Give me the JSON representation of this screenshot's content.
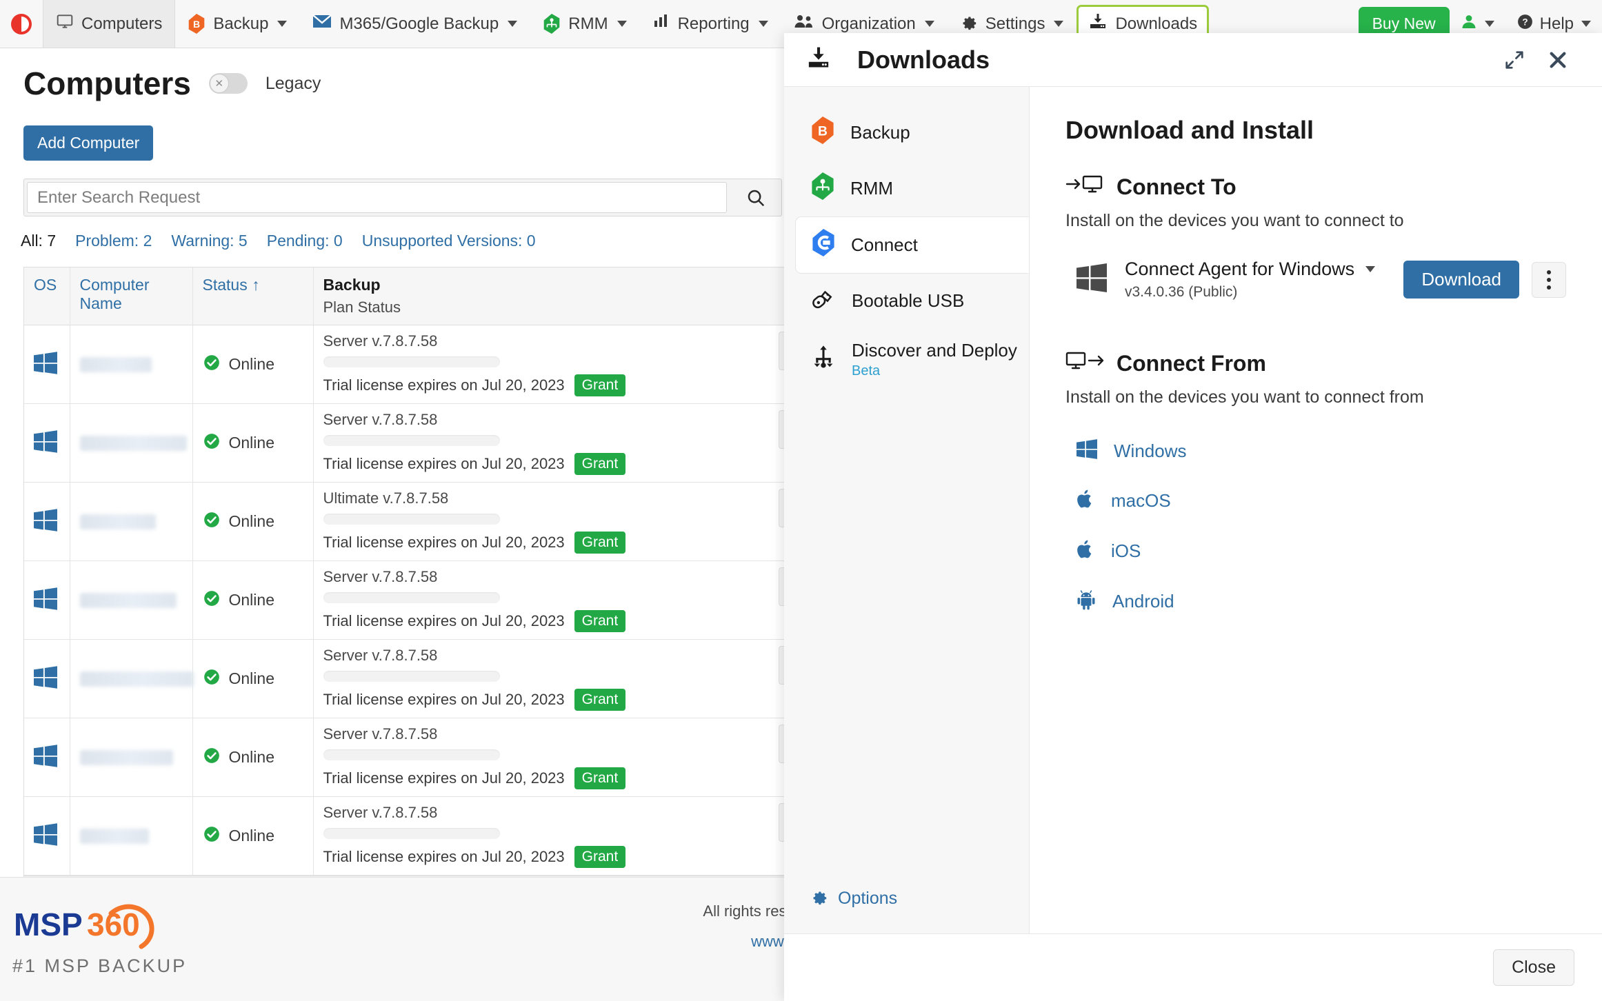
{
  "nav": {
    "logo_icon": "msp360-mark-icon",
    "items": [
      {
        "label": "Computers",
        "icon": "monitor-icon",
        "caret": false,
        "active": true,
        "boxed": false
      },
      {
        "label": "Backup",
        "icon": "backup-hex-icon",
        "caret": true,
        "active": false,
        "boxed": false
      },
      {
        "label": "M365/Google Backup",
        "icon": "envelope-icon",
        "caret": true,
        "active": false,
        "boxed": false
      },
      {
        "label": "RMM",
        "icon": "rmm-hex-icon",
        "caret": true,
        "active": false,
        "boxed": false
      },
      {
        "label": "Reporting",
        "icon": "bar-chart-icon",
        "caret": true,
        "active": false,
        "boxed": false
      },
      {
        "label": "Organization",
        "icon": "users-icon",
        "caret": true,
        "active": false,
        "boxed": false
      },
      {
        "label": "Settings",
        "icon": "gear-icon",
        "caret": true,
        "active": false,
        "boxed": false
      },
      {
        "label": "Downloads",
        "icon": "download-tray-icon",
        "caret": false,
        "active": false,
        "boxed": true
      }
    ],
    "buy_new_label": "Buy New",
    "account_icon": "user-icon",
    "help_label": "Help",
    "help_icon": "question-circle-icon"
  },
  "page": {
    "title": "Computers",
    "legacy_toggle_label": "Legacy",
    "legacy_toggle_state": "off",
    "add_computer_label": "Add Computer",
    "search_placeholder": "Enter Search Request",
    "search_value": "",
    "search_icon": "search-icon",
    "filters": [
      {
        "label": "All: 7",
        "active": true
      },
      {
        "label": "Problem: 2",
        "active": false
      },
      {
        "label": "Warning: 5",
        "active": false
      },
      {
        "label": "Pending: 0",
        "active": false
      },
      {
        "label": "Unsupported Versions: 0",
        "active": false
      }
    ],
    "table": {
      "headers": {
        "os": "OS",
        "computer_name": "Computer Name",
        "status": "Status",
        "status_sort_icon": "sort-asc-arrow-icon",
        "backup": "Backup",
        "backup_sub": "Plan Status"
      },
      "rows": [
        {
          "os_icon": "windows-icon",
          "name": "",
          "status": "Online",
          "status_icon": "check-circle-icon",
          "plan": "Server v.7.8.7.58",
          "license": "Trial license expires on Jul 20, 2023",
          "grant": "Grant"
        },
        {
          "os_icon": "windows-icon",
          "name": "",
          "status": "Online",
          "status_icon": "check-circle-icon",
          "plan": "Server v.7.8.7.58",
          "license": "Trial license expires on Jul 20, 2023",
          "grant": "Grant"
        },
        {
          "os_icon": "windows-icon",
          "name": "",
          "status": "Online",
          "status_icon": "check-circle-icon",
          "plan": "Ultimate v.7.8.7.58",
          "license": "Trial license expires on Jul 20, 2023",
          "grant": "Grant"
        },
        {
          "os_icon": "windows-icon",
          "name": "",
          "status": "Online",
          "status_icon": "check-circle-icon",
          "plan": "Server v.7.8.7.58",
          "license": "Trial license expires on Jul 20, 2023",
          "grant": "Grant"
        },
        {
          "os_icon": "windows-icon",
          "name": "",
          "status": "Online",
          "status_icon": "check-circle-icon",
          "plan": "Server v.7.8.7.58",
          "license": "Trial license expires on Jul 20, 2023",
          "grant": "Grant"
        },
        {
          "os_icon": "windows-icon",
          "name": "",
          "status": "Online",
          "status_icon": "check-circle-icon",
          "plan": "Server v.7.8.7.58",
          "license": "Trial license expires on Jul 20, 2023",
          "grant": "Grant"
        },
        {
          "os_icon": "windows-icon",
          "name": "",
          "status": "Online",
          "status_icon": "check-circle-icon",
          "plan": "Server v.7.8.7.58",
          "license": "Trial license expires on Jul 20, 2023",
          "grant": "Grant"
        }
      ]
    }
  },
  "footer": {
    "logo_text_a": "MSP",
    "logo_text_b": "360",
    "tagline": "#1 MSP BACKUP",
    "rights": "All rights reser",
    "site": "www.m"
  },
  "panel": {
    "title": "Downloads",
    "title_icon": "download-tray-icon",
    "expand_icon": "expand-diagonal-icon",
    "close_icon": "close-x-icon",
    "sidebar": [
      {
        "label": "Backup",
        "icon": "backup-hex-icon",
        "selected": false,
        "sub": ""
      },
      {
        "label": "RMM",
        "icon": "rmm-hex-icon",
        "selected": false,
        "sub": ""
      },
      {
        "label": "Connect",
        "icon": "connect-hex-icon",
        "selected": true,
        "sub": ""
      },
      {
        "label": "Bootable USB",
        "icon": "usb-stick-icon",
        "selected": false,
        "sub": ""
      },
      {
        "label": "Discover and Deploy",
        "icon": "usb-tree-icon",
        "selected": false,
        "sub": "Beta"
      }
    ],
    "options_label": "Options",
    "options_icon": "gear-icon",
    "main": {
      "heading": "Download and Install",
      "connect_to": {
        "heading": "Connect To",
        "heading_icon": "arrow-to-monitor-icon",
        "description": "Install on the devices you want to connect to",
        "agent": {
          "icon": "windows-icon",
          "name": "Connect Agent for Windows",
          "dropdown_icon": "caret-down-icon",
          "version": "v3.4.0.36 (Public)",
          "download_label": "Download",
          "menu_icon": "kebab-menu-icon"
        }
      },
      "connect_from": {
        "heading": "Connect From",
        "heading_icon": "monitor-to-arrow-icon",
        "description": "Install on the devices you want to connect from",
        "platforms": [
          {
            "label": "Windows",
            "icon": "windows-icon"
          },
          {
            "label": "macOS",
            "icon": "apple-icon"
          },
          {
            "label": "iOS",
            "icon": "apple-icon"
          },
          {
            "label": "Android",
            "icon": "android-icon"
          }
        ]
      }
    },
    "close_button_label": "Close"
  },
  "colors": {
    "accent_blue": "#2f6fa5",
    "green": "#27b24a",
    "grant_green": "#22a844",
    "highlight_green": "#9ccc3c",
    "backup_orange": "#ef6524",
    "rmm_green": "#22a844",
    "connect_blue": "#2f7ef0",
    "beta_teal": "#2d9fd0"
  }
}
